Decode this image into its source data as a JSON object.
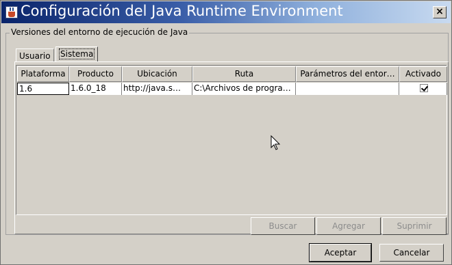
{
  "window": {
    "title": "Configuración del Java Runtime Environment",
    "close_label": "×"
  },
  "group": {
    "legend": "Versiones del entorno de ejecución de Java"
  },
  "tabs": [
    {
      "label": "Usuario",
      "selected": false
    },
    {
      "label": "Sistema",
      "selected": true
    }
  ],
  "table": {
    "headers": [
      "Plataforma",
      "Producto",
      "Ubicación",
      "Ruta",
      "Parámetros del entor…",
      "Activado"
    ],
    "rows": [
      {
        "plataforma": "1.6",
        "producto": "1.6.0_18",
        "ubicacion": "http://java.s…",
        "ruta": "C:\\Archivos de progra…",
        "parametros": "",
        "activado": true
      }
    ]
  },
  "buttons": {
    "buscar": "Buscar",
    "agregar": "Agregar",
    "suprimir": "Suprimir",
    "aceptar": "Aceptar",
    "cancelar": "Cancelar"
  }
}
